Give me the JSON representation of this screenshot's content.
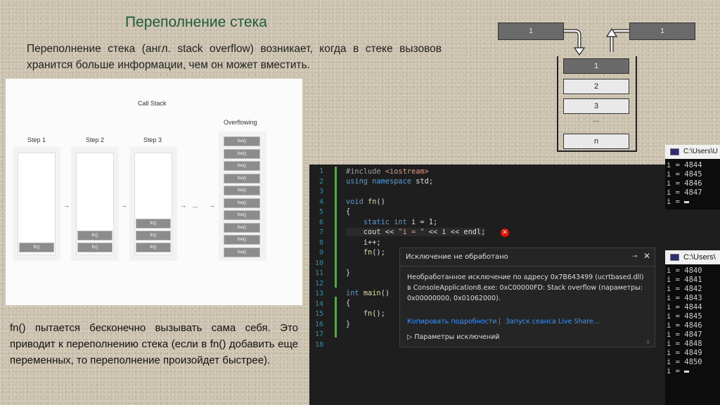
{
  "title": "Переполнение стека",
  "intro_text": "Переполнение стека (англ. stack overflow) возникает, когда в стеке вызовов хранится больше информации, чем он может вместить.",
  "bottom_text": "fn() пытается бесконечно вызывать сама себя. Это приводит к переполнению стека (если в fn() добавить еще переменных, то переполнение произойдет быстрее).",
  "diagram": {
    "title": "Call Stack",
    "steps": [
      "Step 1",
      "Step 2",
      "Step 3"
    ],
    "overflow_label": "Overflowing",
    "cell_label": "fn()",
    "overflow_cell_label": "foo()",
    "arrow": "→",
    "dots": "..."
  },
  "stack_schema": {
    "push_value": "1",
    "pop_value": "1",
    "cells": [
      "1",
      "2",
      "3",
      "...",
      "n"
    ]
  },
  "editor": {
    "line_numbers": [
      "1",
      "2",
      "3",
      "4",
      "5",
      "6",
      "7",
      "8",
      "9",
      "10",
      "11",
      "12",
      "13",
      "14",
      "15",
      "16",
      "17",
      "18"
    ]
  },
  "exception": {
    "title": "Исключение не обработано",
    "message": "Необработанное исключение по адресу 0x7B643499 (ucrtbased.dll) в ConsoleApplication8.exe: 0xC00000FD: Stack overflow (параметры: 0x00000000, 0x01062000).",
    "copy_details": "Копировать подробности",
    "separator": "|",
    "live_share": "Запуск сеанса Live Share...",
    "params": "Параметры исключений",
    "pin_icon": "pin-icon",
    "close_icon": "close-icon"
  },
  "console_top": {
    "caption": "C:\\Users\\U",
    "lines": [
      "i = 4844",
      "i = 4845",
      "i = 4846",
      "i = 4847",
      "i = "
    ]
  },
  "console_bottom": {
    "caption": "C:\\Users\\",
    "lines": [
      "i = 4840",
      "i = 4841",
      "i = 4842",
      "i = 4843",
      "i = 4844",
      "i = 4845",
      "i = 4846",
      "i = 4847",
      "i = 4848",
      "i = 4849",
      "i = 4850",
      "i = "
    ]
  }
}
